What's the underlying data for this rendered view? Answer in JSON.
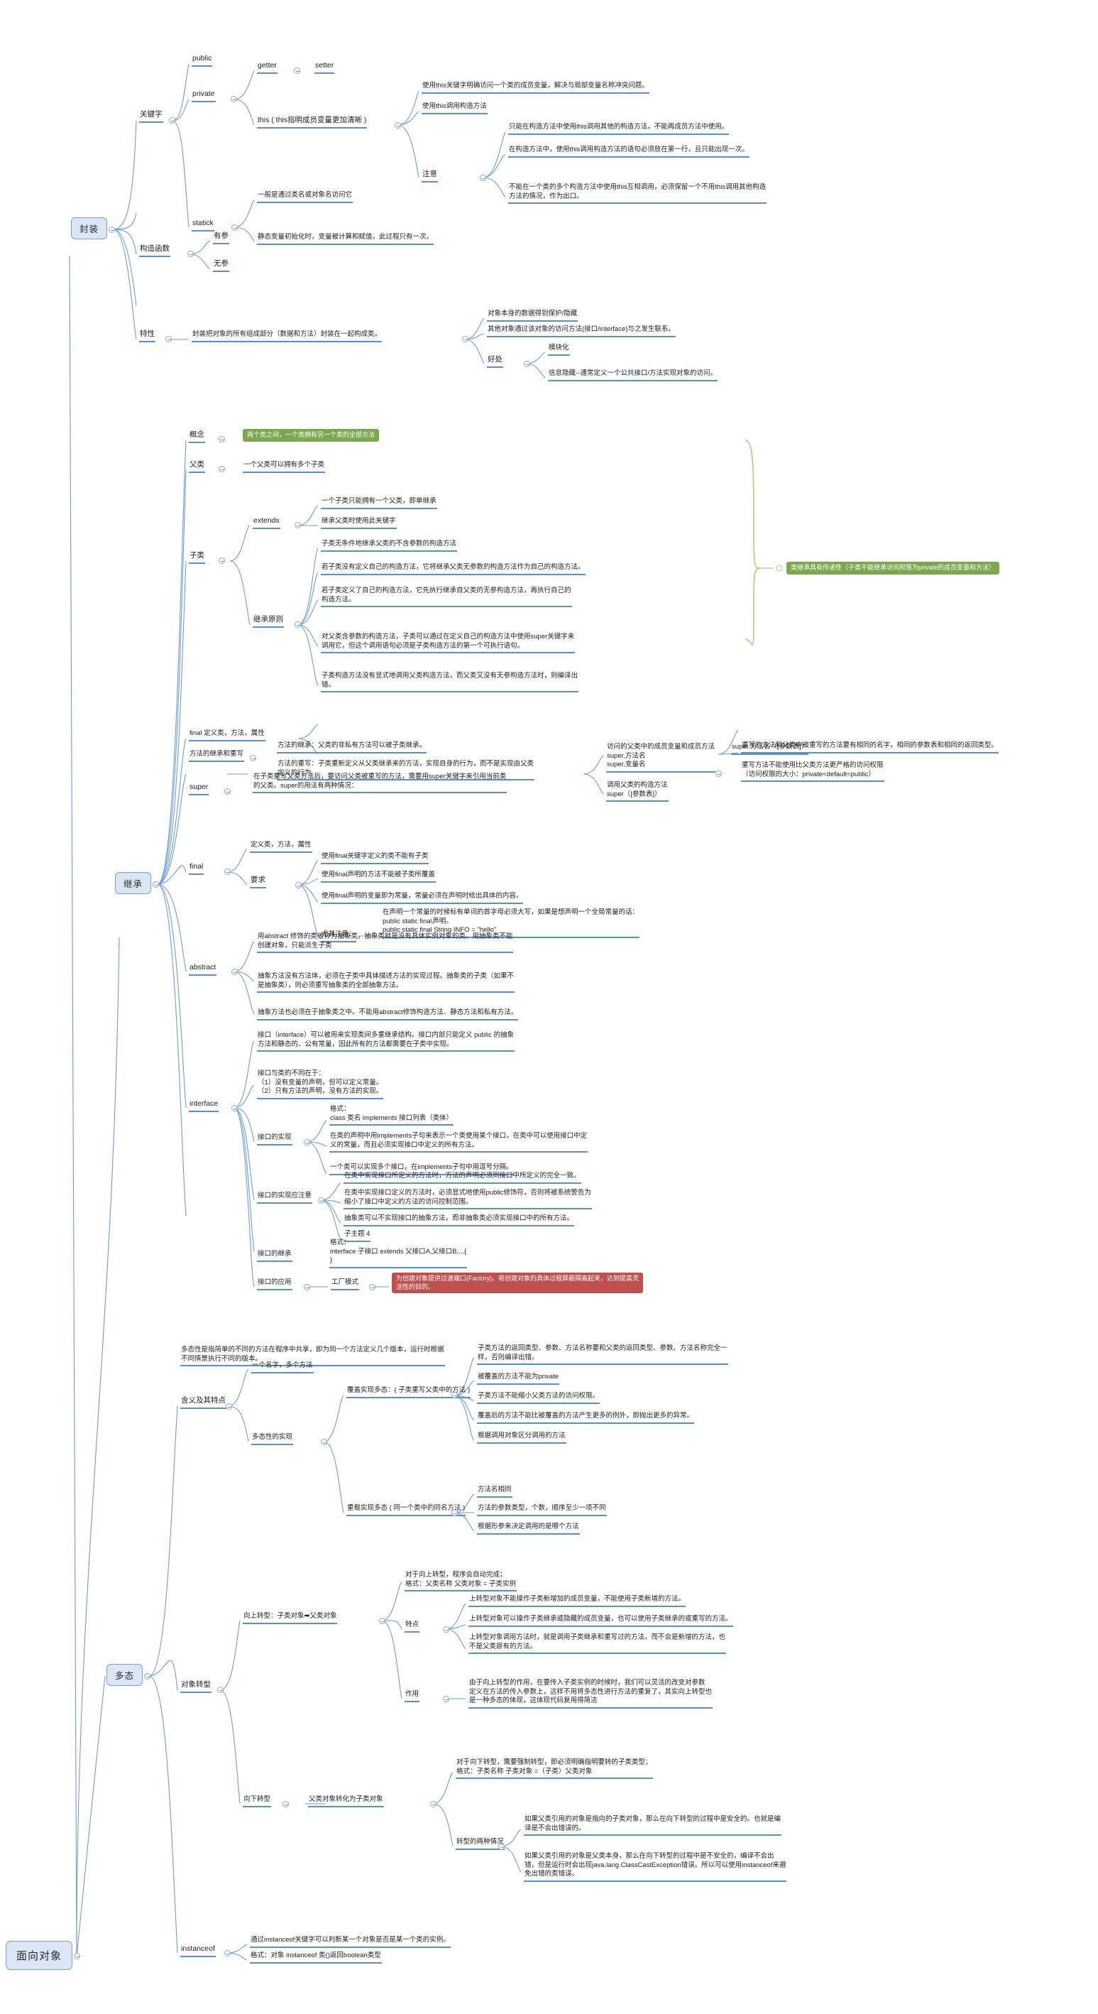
{
  "title": "面向对象",
  "root": {
    "label": "面向对象"
  },
  "branches": [
    {
      "id": "encapsulation",
      "label": "封装"
    },
    {
      "id": "inheritance",
      "label": "继承"
    },
    {
      "id": "polymorphism",
      "label": "多态"
    }
  ],
  "encapsulation": {
    "keyword": {
      "label": "关键字"
    },
    "public": {
      "label": "public"
    },
    "private": {
      "label": "private"
    },
    "getter": {
      "label": "getter"
    },
    "setter": {
      "label": "setter"
    },
    "this": {
      "label": "this ( this指明成员变量更加清晰 )"
    },
    "this_items": [
      "使用this关键字明确访问一个类的成员变量，解决与局部变量名称冲突问题。",
      "使用this调用构造方法"
    ],
    "notice": {
      "label": "注意"
    },
    "notice_items": [
      "只能在构造方法中使用this调用其他的构造方法，不能再成员方法中使用。",
      "在构造方法中，使用this调用构造方法的语句必须放在第一行，且只能出现一次。",
      "不能在一个类的多个构造方法中使用this互相调用，必须保留一个不用this调用其他构造\n方法的情况，作为出口。"
    ],
    "statick": {
      "label": "statick"
    },
    "statick_items": [
      "一般是通过类名或对象名访问它",
      "静态变量初始化时，变量被计算和赋值，此过程只有一次。"
    ],
    "constructor": {
      "label": "构造函数"
    },
    "constructor_items": [
      "有参",
      "无参"
    ],
    "feature": {
      "label": "特性"
    },
    "feature_desc": "封装把对象的所有组成部分（数据和方法）封装在一起构成类。",
    "feature_items": [
      "对象本身的数据得到保护/隐藏",
      "其他对象通过该对象的访问方法(接口/interface)与之发生联系。"
    ],
    "benefit": {
      "label": "好处"
    },
    "benefit_items": [
      "模块化",
      "信息隐藏--通常定义一个公共接口/方法实现对象的访问。"
    ]
  },
  "inheritance": {
    "concept": {
      "label": "概念"
    },
    "concept_hl": "两个类之间，一个类拥有另一个类的全部方法",
    "parent": {
      "label": "父类"
    },
    "parent_desc": "一个父类可以拥有多个子类",
    "child": {
      "label": "子类"
    },
    "extends": {
      "label": "extends"
    },
    "extends_items": [
      "一个子类只能拥有一个父类，即单继承",
      "继承父类时使用此关键字"
    ],
    "rules": {
      "label": "继承原则"
    },
    "rules_items": [
      "子类无条件地继承父类的不含参数的构造方法",
      "若子类没有定义自己的构造方法，它将继承父类无参数的构造方法作为自己的构造方法。",
      "若子类定义了自己的构造方法，它先执行继承自父类的无参构造方法，再执行自己的\n构造方法。",
      "对父类含参数的构造方法，子类可以通过在定义自己的构造方法中使用super关键字来\n调用它，但这个调用语句必须是子类构造方法的第一个可执行语句。",
      "子类构造方法没有显式地调用父类构造方法，而父类又没有无参构造方法时，则编译出\n错。"
    ],
    "rules_hl": "类继承具有传递性（子类不能继承访问权限为private的成员变量和方法）",
    "final_top": {
      "label": "final 定义类，方法，属性"
    },
    "override": {
      "label": "方法的继承和重写"
    },
    "override_items": [
      "方法的继承：父类的非私有方法可以被子类继承。",
      "方法的重写：子类重新定义从父类继承来的方法，实现自身的行为，而不是实现由父类\n定义的行为"
    ],
    "override_rules": [
      "重写的方法和父类中被重写的方法要有相同的名字，相同的参数表和相同的返回类型。",
      "重写方法不能使用比父类方法更严格的访问权限\n（访问权限的大小：private<default<public）"
    ],
    "super": {
      "label": "super"
    },
    "super_desc": "在子类重写父类方法后，要访问父类被重写的方法，需要用super关键字来引用当前类\n的父类。super的用法有两种情况：",
    "super_items": [
      "访问的父类中的成员变量和成员方法\n      super.方法名\n      super.变量名",
      "调用父类的构造方法\n      super（[参数表]）"
    ],
    "super_item_extra": "super.方法名（[参数表]）",
    "final": {
      "label": "final"
    },
    "final_def": "定义类，方法，属性",
    "final_req": {
      "label": "要求"
    },
    "final_items": [
      "使用final关键字定义的类不能有子类",
      "使用final声明的方法不能被子类所覆盖",
      "使用final声明的变量即为常量，常量必须在声明时给出具体的内容。"
    ],
    "final_note": {
      "label": "尤其注意："
    },
    "final_note_text": "在声明一个常量的时候标有单词的首字母必须大写，如果是想声明一个全局常量的话：\n      public static fina\\声明。\n      public static final String INFO = \"hello\"",
    "abstract": {
      "label": "abstract"
    },
    "abstract_items": [
      "用abstract 修饰的类被称为抽象类。抽象类就是没有具体实例对象的类。用抽象类不能\n创建对象，只能派生子类",
      "抽象方法没有方法体，必须在子类中具体描述方法的实现过程。抽象类的子类（如果不\n是抽象类），则必须重写抽象类的全部抽象方法。",
      "抽象方法也必须在于抽象类之中。不能用abstract修饰构造方法、静态方法和私有方法。"
    ],
    "interface": {
      "label": "interface"
    },
    "interface_desc": "接口（interface）可以被用来实现类间多重继承结构。接口内部只能定义 public 的抽象\n方法和静态的、公有常量，因此所有的方法都需要在子类中实现。",
    "diff": {
      "label": "接口与类的不同在于："
    },
    "diff_text": "接口与类的不同在于：\n（1）没有变量的声明，但可以定义常量。\n（2）只有方法的声明，没有方法的实现。",
    "impl": {
      "label": "接口的实现"
    },
    "impl_format": "格式：\n    class 类名 implements 接口列表（类体）",
    "impl_items": [
      "在类的声明中用implements子句来表示一个类使用某个接口，在类中可以使用接口中定\n义的常量，而且必须实现接口中定义的所有方法。",
      "一个类可以实现多个接口，在implements子句中用逗号分隔。"
    ],
    "impl_notes": {
      "label": "接口的实现应注意"
    },
    "impl_notes_items": [
      "在类中实现接口所定义的方法时，方法的声明必须同接口中所定义的完全一致。",
      "在类中实现接口定义的方法时，必须显式地使用public修饰符，否则将被系统警告为\n缩小了接口中定义的方法的访问控制范围。",
      "抽象类可以不实现接口的抽象方法，而非抽象类必须实现接口中的所有方法。",
      "子主题 4"
    ],
    "inherit": {
      "label": "接口的继承"
    },
    "inherit_text": "格式：\ninterface 子接口 extends 父接口A,父接口B,...{\n}",
    "apply": {
      "label": "接口的应用"
    },
    "factory": {
      "label": "工厂模式"
    },
    "factory_hl": "为创建对象提供过渡端口(Factory)，将创建对象的具体过程屏蔽隔离起来，达到提高灵\n活性的目的。"
  },
  "polymorphism": {
    "meaning": {
      "label": "含义及其特点"
    },
    "meaning_desc": "多态性是指简单的不同的方法在程序中共享，即为同一个方法定义几个版本，运行时根据\n不同情景执行不同的版本。",
    "one_name": "一个名字，多个方法",
    "impl": {
      "label": "多态性的实现"
    },
    "override": {
      "label": "覆盖实现多态：( 子类重写父类中的方法 )"
    },
    "override_items": [
      "子类方法的返回类型、参数、方法名称要和父类的返回类型、参数、方法名称完全一\n样，否则编译出错。",
      "被覆盖的方法不能为private",
      "子类方法不能缩小父类方法的访问权限。",
      "覆盖后的方法不能比被覆盖的方法产生更多的例外，即抛出更多的异常。",
      "根据调用对象区分调用的方法"
    ],
    "overload": {
      "label": "重载实现多态 ( 同一个类中的同名方法 )"
    },
    "overload_items": [
      "方法名相同",
      "方法的参数类型，个数，顺序至少一项不同",
      "根据形参来决定调用的是哪个方法"
    ],
    "cast": {
      "label": "对象转型"
    },
    "up": {
      "label": "向上转型：子类对象➡父类对象"
    },
    "up_format": "对于向上转型，程序会自动完成；\n格式：父类名称 父类对象 = 子类实例",
    "up_points": {
      "label": "特点"
    },
    "up_points_items": [
      "上转型对象不能操作子类新增加的成员变量，不能使用子类新增的方法。",
      "上转型对象可以操作子类继承或隐藏的成员变量，也可以使用子类继承的或重写的方法。",
      "上转型对象调用方法时，就是调用子类继承和重写过的方法，而不会是新增的方法，也\n不是父类原有的方法。"
    ],
    "up_use": {
      "label": "作用"
    },
    "up_use_text": "由于向上转型的作用，在要传入子类实例的时候时，我们可以灵活的改变对参数\n定义在方法的传入参数上，这样不用将多态性进行方法的重复了，其实向上转型也\n是一种多态的体现，这体现代码复用得简洁",
    "down": {
      "label": "向下转型"
    },
    "down_desc": "父类对象转化为子类对象",
    "down_format": "对于向下转型，需要强制转型，即必须明确指明要转的子类类型；\n格式：子类名称 子类对象 =（子类）父类对象",
    "down_cases": {
      "label": "转型的两种情况"
    },
    "down_cases_items": [
      "如果父类引用的对象是指向的子类对象，那么在向下转型的过程中是安全的。也就是编\n译是不会出错误的。",
      "如果父类引用的对象是父类本身，那么在向下转型的过程中是不安全的，编译不会出\n错，但是运行时会出现java.lang.ClassCastException错误。所以可以使用instanceof来避\n免出错的类错误。"
    ],
    "instanceof": {
      "label": "instanceof"
    },
    "instanceof_items": [
      "通过instanceof关键字可以判断某一个对象是否是某一个类的实例。",
      "格式：对象 instanceof 类()返回boolean类型"
    ]
  }
}
